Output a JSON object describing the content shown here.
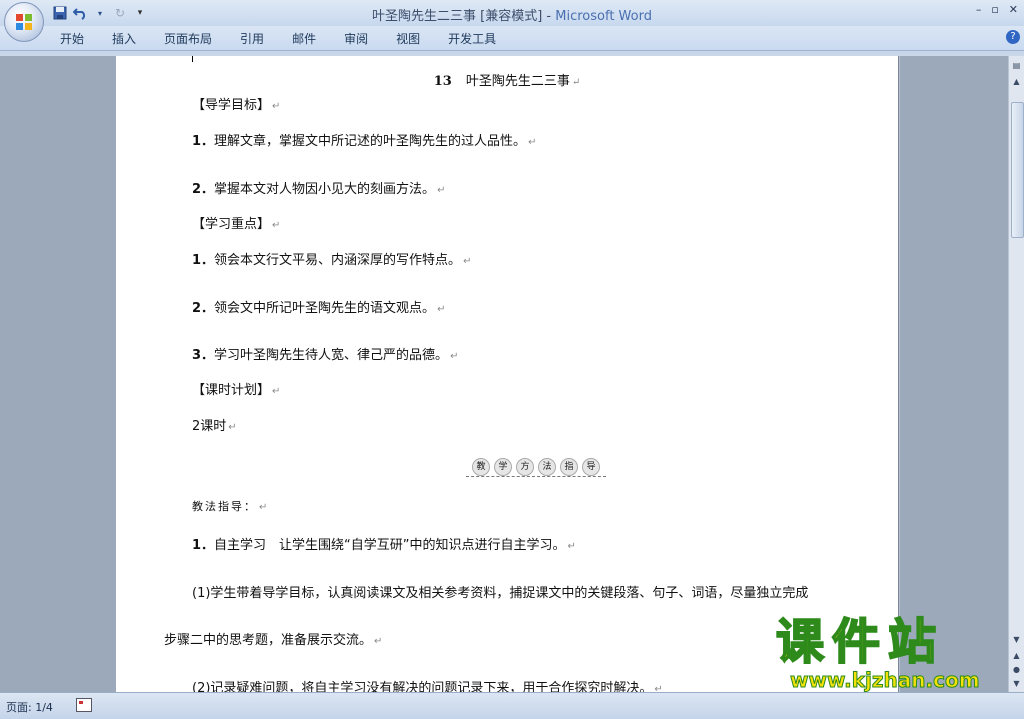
{
  "window": {
    "doc_name": "叶圣陶先生二三事 [兼容模式]",
    "separator": " - ",
    "app_name": "Microsoft Word"
  },
  "quick_access": {
    "save_icon": "save-icon",
    "undo_icon": "undo-icon",
    "redo_icon": "redo-icon",
    "customize_icon": "customize-qat-icon"
  },
  "ribbon": {
    "tabs": [
      "开始",
      "插入",
      "页面布局",
      "引用",
      "邮件",
      "审阅",
      "视图",
      "开发工具"
    ],
    "help_label": "?"
  },
  "document": {
    "title_num": "13",
    "title_text": "叶圣陶先生二三事",
    "para_mark": "↵",
    "lines": [
      {
        "num": "",
        "text": "【导学目标】"
      },
      {
        "num": "1．",
        "text": "理解文章，掌握文中所记述的叶圣陶先生的过人品性。"
      },
      {
        "num": "2．",
        "text": "掌握本文对人物因小见大的刻画方法。"
      },
      {
        "num": "",
        "text": "【学习重点】"
      },
      {
        "num": "1．",
        "text": "领会本文行文平易、内涵深厚的写作特点。"
      },
      {
        "num": "2．",
        "text": "领会文中所记叶圣陶先生的语文观点。"
      },
      {
        "num": "3．",
        "text": "学习叶圣陶先生待人宽、律己严的品德。"
      },
      {
        "num": "",
        "text": "【课时计划】"
      },
      {
        "num": "",
        "text": "2课时"
      }
    ],
    "stamp_chars": [
      "教",
      "学",
      "方",
      "法",
      "指",
      "导"
    ],
    "method_label": "教法指导：",
    "step1_num": "1．",
    "step1_text": "自主学习　让学生围绕“自学互研”中的知识点进行自主学习。",
    "para1_line1": "(1)学生带着导学目标，认真阅读课文及相关参考资料，捕捉课文中的关键段落、句子、词语，尽量独立完成",
    "para1_line2": "步骤二中的思考题，准备展示交流。",
    "para2": "(2)记录疑难问题，将自主学习没有解决的问题记录下来，用于合作探究时解决。"
  },
  "status": {
    "page_label": "页面: 1/4"
  },
  "watermark": {
    "cn": "课件站",
    "url": "www.kjzhan.com"
  }
}
